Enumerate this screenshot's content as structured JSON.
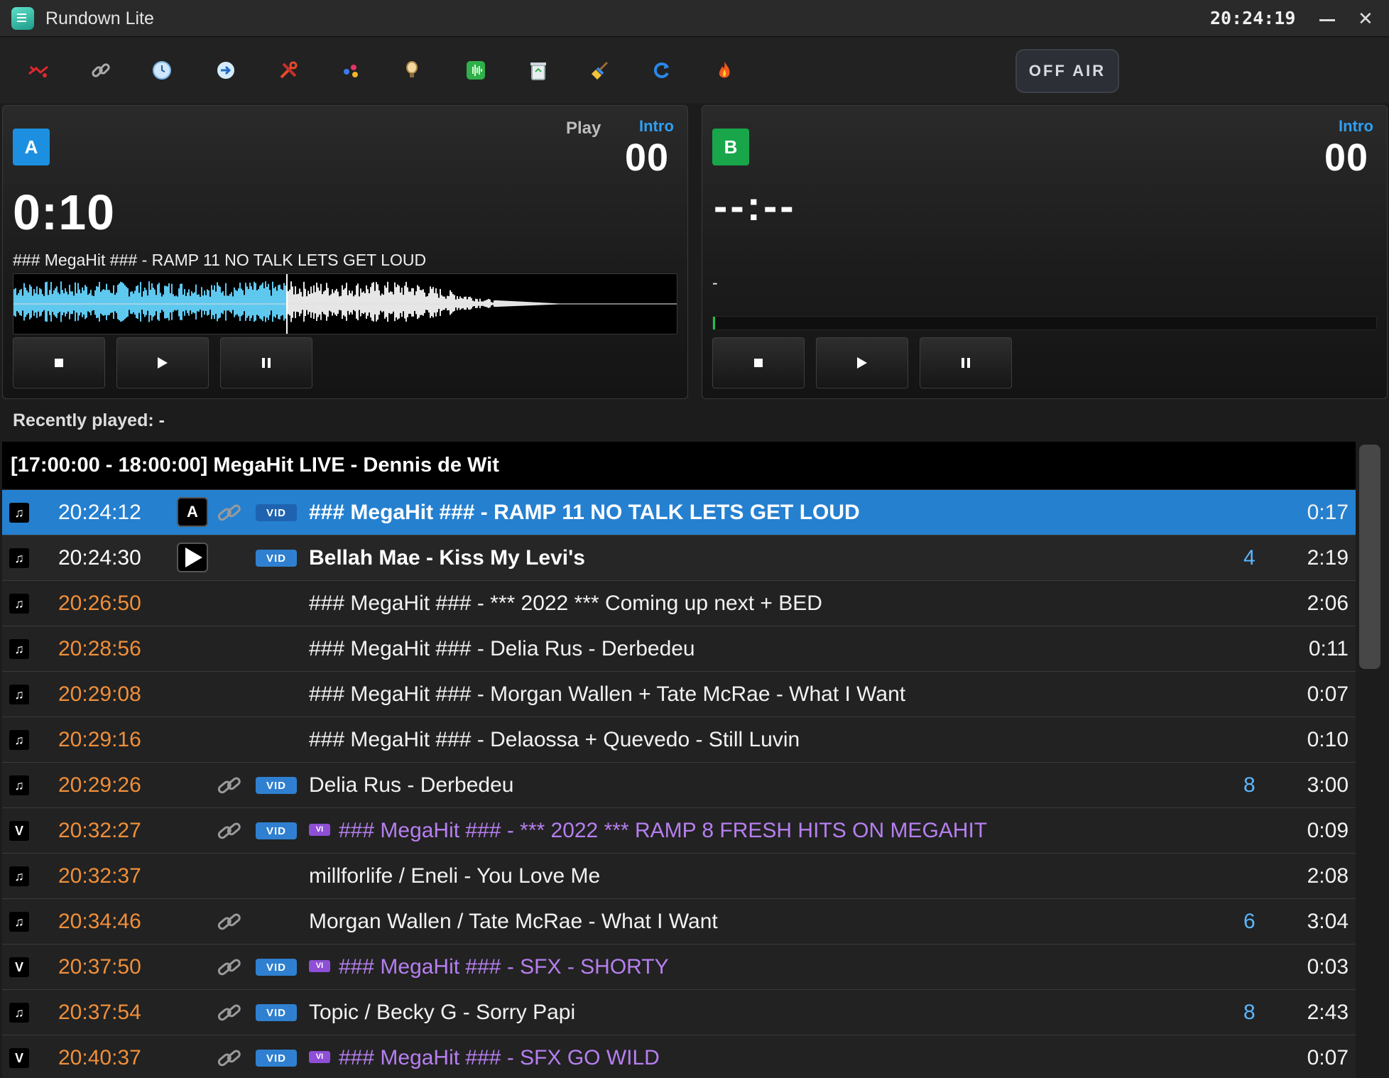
{
  "window": {
    "title": "Rundown Lite",
    "clock": "20:24:19"
  },
  "toolbar": {
    "tools": [
      "broken-satellite-icon",
      "link-icon",
      "clock-icon",
      "arrow-right-circle-icon",
      "wrench-tools-icon",
      "molecule-dots-icon",
      "lightbulb-icon",
      "audio-waveform-icon",
      "recycle-bin-icon",
      "broom-icon",
      "refresh-icon",
      "flame-icon"
    ],
    "off_air_label": "OFF AIR"
  },
  "player_a": {
    "badge": "A",
    "play_label": "Play",
    "intro_label": "Intro",
    "intro_value": "00",
    "time": "0:10",
    "title": "### MegaHit ### - RAMP 11 NO TALK LETS GET LOUD",
    "progress": 0.41,
    "wave_color_played": "#5ec8ef",
    "wave_color_rest": "#e6e6e6"
  },
  "player_b": {
    "badge": "B",
    "intro_label": "Intro",
    "intro_value": "00",
    "time": "--:--",
    "title": "-",
    "progress": 0.0
  },
  "recent": {
    "label": "Recently played: -"
  },
  "rundown": {
    "block_header": "[17:00:00 - 18:00:00] MegaHit LIVE - Dennis de Wit",
    "rows": [
      {
        "type": "music",
        "type_glyph": "♫",
        "time": "20:24:12",
        "marker": "A",
        "link": true,
        "vid": "VID",
        "vi": "",
        "title": "### MegaHit ### - RAMP 11 NO TALK LETS GET LOUD",
        "count": "",
        "duration": "0:17",
        "state": "active"
      },
      {
        "type": "music",
        "type_glyph": "♫",
        "time": "20:24:30",
        "marker": "play",
        "link": false,
        "vid": "VID",
        "vi": "",
        "title": "Bellah Mae - Kiss My Levi's",
        "count": "4",
        "duration": "2:19",
        "state": "next"
      },
      {
        "type": "music",
        "type_glyph": "♫",
        "time": "20:26:50",
        "marker": "",
        "link": false,
        "vid": "",
        "vi": "",
        "title": "### MegaHit ### - *** 2022 *** Coming up next + BED",
        "count": "",
        "duration": "2:06",
        "state": ""
      },
      {
        "type": "music",
        "type_glyph": "♫",
        "time": "20:28:56",
        "marker": "",
        "link": false,
        "vid": "",
        "vi": "",
        "title": "### MegaHit ### - Delia Rus - Derbedeu",
        "count": "",
        "duration": "0:11",
        "state": ""
      },
      {
        "type": "music",
        "type_glyph": "♫",
        "time": "20:29:08",
        "marker": "",
        "link": false,
        "vid": "",
        "vi": "",
        "title": "### MegaHit ### - Morgan Wallen + Tate McRae - What I Want",
        "count": "",
        "duration": "0:07",
        "state": ""
      },
      {
        "type": "music",
        "type_glyph": "♫",
        "time": "20:29:16",
        "marker": "",
        "link": false,
        "vid": "",
        "vi": "",
        "title": "### MegaHit ### - Delaossa + Quevedo - Still Luvin",
        "count": "",
        "duration": "0:10",
        "state": ""
      },
      {
        "type": "music",
        "type_glyph": "♫",
        "time": "20:29:26",
        "marker": "",
        "link": true,
        "vid": "VID",
        "vi": "",
        "title": "Delia Rus - Derbedeu",
        "count": "8",
        "duration": "3:00",
        "state": ""
      },
      {
        "type": "video",
        "type_glyph": "V",
        "time": "20:32:27",
        "marker": "",
        "link": true,
        "vid": "VID",
        "vi": "VI",
        "title": "### MegaHit ### - *** 2022 *** RAMP 8 FRESH HITS ON MEGAHIT",
        "count": "",
        "duration": "0:09",
        "state": ""
      },
      {
        "type": "music",
        "type_glyph": "♫",
        "time": "20:32:37",
        "marker": "",
        "link": false,
        "vid": "",
        "vi": "",
        "title": "millforlife / Eneli - You Love Me",
        "count": "",
        "duration": "2:08",
        "state": ""
      },
      {
        "type": "music",
        "type_glyph": "♫",
        "time": "20:34:46",
        "marker": "",
        "link": true,
        "vid": "",
        "vi": "",
        "title": "Morgan Wallen / Tate McRae - What I Want",
        "count": "6",
        "duration": "3:04",
        "state": ""
      },
      {
        "type": "video",
        "type_glyph": "V",
        "time": "20:37:50",
        "marker": "",
        "link": true,
        "vid": "VID",
        "vi": "VI",
        "title": "### MegaHit ### - SFX - SHORTY",
        "count": "",
        "duration": "0:03",
        "state": ""
      },
      {
        "type": "music",
        "type_glyph": "♫",
        "time": "20:37:54",
        "marker": "",
        "link": true,
        "vid": "VID",
        "vi": "",
        "title": "Topic / Becky G - Sorry Papi",
        "count": "8",
        "duration": "2:43",
        "state": ""
      },
      {
        "type": "video",
        "type_glyph": "V",
        "time": "20:40:37",
        "marker": "",
        "link": true,
        "vid": "VID",
        "vi": "VI",
        "title": "### MegaHit ### - SFX GO WILD",
        "count": "",
        "duration": "0:07",
        "state": ""
      }
    ]
  }
}
